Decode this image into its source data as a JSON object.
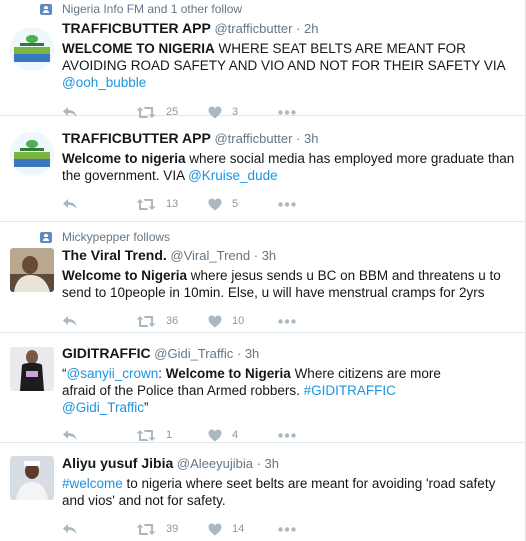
{
  "tweets": [
    {
      "context": "Nigeria Info FM and 1 other follow",
      "name": "TRAFFICBUTTER APP",
      "handle": "@trafficbutter",
      "time": "2h",
      "segments": [
        {
          "text": "WELCOME TO  NIGERIA",
          "bold": true
        },
        {
          "text": " WHERE SEAT BELTS ARE MEANT FOR AVOIDING ROAD SAFETY AND VIO AND NOT FOR THEIR SAFETY VIA "
        },
        {
          "text": "@ooh_bubble",
          "link": true
        }
      ],
      "retweets": "25",
      "likes": "3"
    },
    {
      "name": "TRAFFICBUTTER APP",
      "handle": "@trafficbutter",
      "time": "3h",
      "segments": [
        {
          "text": "Welcome to nigeria",
          "bold": true
        },
        {
          "text": " where social media has employed more graduate than the government. VIA  "
        },
        {
          "text": "@Kruise_dude",
          "link": true
        }
      ],
      "retweets": "13",
      "likes": "5"
    },
    {
      "context": "Mickypepper follows",
      "name": "The Viral Trend.",
      "handle": "@Viral_Trend",
      "time": "3h",
      "segments": [
        {
          "text": "Welcome to Nigeria",
          "bold": true
        },
        {
          "text": " where jesus sends u BC on BBM and threatens u to send to 10people in 10min. Else, u will have menstrual cramps for 2yrs"
        }
      ],
      "retweets": "36",
      "likes": "10"
    },
    {
      "name": "GIDITRAFFIC",
      "handle": "@Gidi_Traffic",
      "time": "3h",
      "segments": [
        {
          "text": "“"
        },
        {
          "text": "@sanyii_crown",
          "link": true
        },
        {
          "text": ": "
        },
        {
          "text": "Welcome to Nigeria",
          "bold": true
        },
        {
          "text": " Where citizens are more afraid of the Police than Armed robbers. "
        },
        {
          "text": "#GIDITRAFFIC",
          "link": true
        },
        {
          "text": "  "
        },
        {
          "text": "@Gidi_Traffic",
          "link": true
        },
        {
          "text": "”"
        }
      ],
      "retweets": "1",
      "likes": "4"
    },
    {
      "name": "Aliyu yusuf Jibia",
      "handle": "@Aleeyujibia",
      "time": "3h",
      "segments": [
        {
          "text": "#welcome",
          "link": true
        },
        {
          "text": " to nigeria where seet belts are meant for avoiding 'road safety and vios' and not for safety."
        }
      ],
      "retweets": "39",
      "likes": "14"
    }
  ],
  "separator": "·",
  "colors": {
    "link": "#1b95e0",
    "muted": "#657786",
    "icon": "#aab8c2"
  }
}
